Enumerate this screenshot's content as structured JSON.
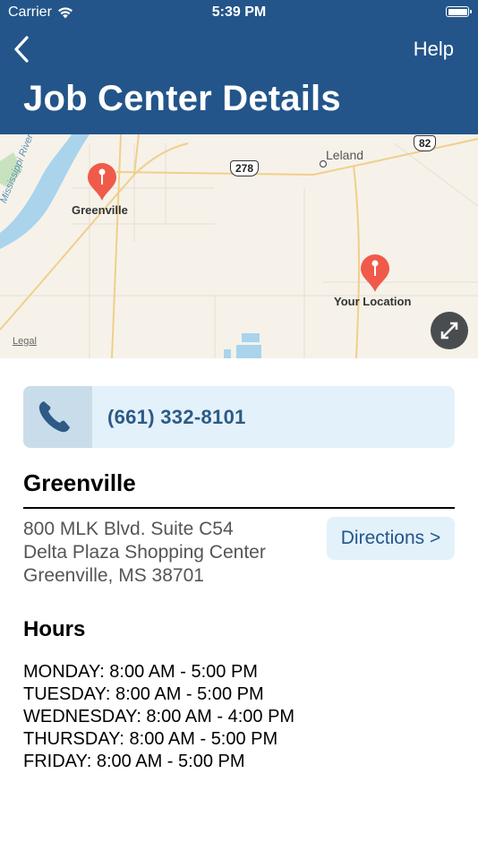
{
  "status_bar": {
    "carrier": "Carrier",
    "time": "5:39 PM"
  },
  "nav": {
    "help_label": "Help",
    "title": "Job Center Details"
  },
  "map": {
    "labels": {
      "greenville": "Greenville",
      "leland": "Leland",
      "your_location": "Your Location",
      "river": "Mississippi River",
      "highway_278": "278",
      "highway_82": "82"
    },
    "legal_label": "Legal",
    "pin_color": "#f05a4a"
  },
  "contact": {
    "phone": "(661) 332-8101"
  },
  "center": {
    "name": "Greenville",
    "address_lines": [
      "800 MLK Blvd. Suite C54",
      "Delta Plaza Shopping Center",
      "Greenville, MS 38701"
    ],
    "directions_label": "Directions >"
  },
  "hours": {
    "title": "Hours",
    "days": [
      "MONDAY: 8:00 AM - 5:00 PM",
      "TUESDAY: 8:00 AM - 5:00 PM",
      "WEDNESDAY: 8:00 AM - 4:00 PM",
      "THURSDAY: 8:00 AM - 5:00 PM",
      "FRIDAY: 8:00 AM - 5:00 PM"
    ]
  },
  "colors": {
    "header": "#23558a",
    "accent": "#2d5a86",
    "button_bg": "#e3f1fb"
  }
}
